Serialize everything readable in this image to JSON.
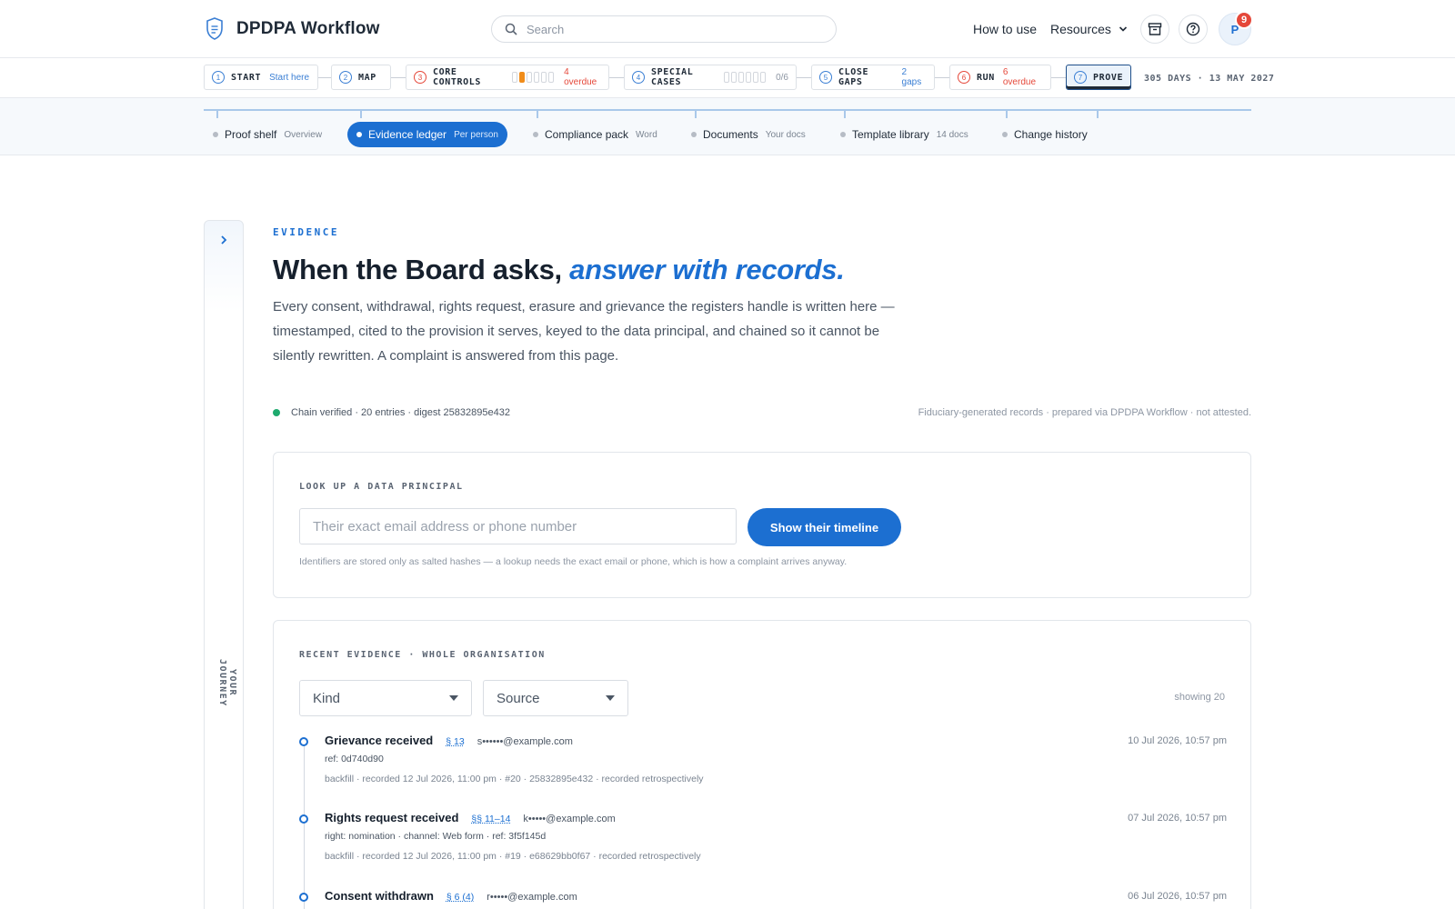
{
  "app": {
    "title": "DPDPA Workflow"
  },
  "search": {
    "placeholder": "Search"
  },
  "nav": {
    "how_to_use": "How to use",
    "resources": "Resources"
  },
  "user": {
    "initial": "P",
    "notifications": "9"
  },
  "steps": [
    {
      "num": "1",
      "label": "START",
      "meta": "Start here",
      "meta_tone": "blue"
    },
    {
      "num": "2",
      "label": "MAP",
      "meta": "",
      "meta_tone": "gray"
    },
    {
      "num": "3",
      "label": "CORE CONTROLS",
      "meta": "4 overdue",
      "meta_tone": "red",
      "progress_on": 1,
      "progress_total": 6
    },
    {
      "num": "4",
      "label": "SPECIAL CASES",
      "meta": "0/6",
      "meta_tone": "gray",
      "progress_on": 0,
      "progress_total": 6
    },
    {
      "num": "5",
      "label": "CLOSE GAPS",
      "meta": "2 gaps",
      "meta_tone": "blue"
    },
    {
      "num": "6",
      "label": "RUN",
      "meta": "6 overdue",
      "meta_tone": "red"
    },
    {
      "num": "7",
      "label": "PROVE",
      "meta": "",
      "meta_tone": "gray",
      "active": true
    }
  ],
  "deadline": "305 DAYS · 13 MAY 2027",
  "subtabs": [
    {
      "label": "Proof shelf",
      "hint": "Overview"
    },
    {
      "label": "Evidence ledger",
      "hint": "Per person",
      "active": true
    },
    {
      "label": "Compliance pack",
      "hint": "Word"
    },
    {
      "label": "Documents",
      "hint": "Your docs"
    },
    {
      "label": "Template library",
      "hint": "14 docs"
    },
    {
      "label": "Change history",
      "hint": ""
    }
  ],
  "rail": {
    "label": "YOUR JOURNEY"
  },
  "page": {
    "eyebrow": "EVIDENCE",
    "headline_plain": "When the Board asks, ",
    "headline_em": "answer with records.",
    "lede": "Every consent, withdrawal, rights request, erasure and grievance the registers handle is written here — timestamped, cited to the provision it serves, keyed to the data principal, and chained so it cannot be silently rewritten. A complaint is answered from this page.",
    "chain_status": "Chain verified · 20 entries · digest 25832895e432",
    "attestation": "Fiduciary-generated records · prepared via DPDPA Workflow · not attested."
  },
  "lookup": {
    "title": "LOOK UP A DATA PRINCIPAL",
    "placeholder": "Their exact email address or phone number",
    "button": "Show their timeline",
    "note": "Identifiers are stored only as salted hashes — a lookup needs the exact email or phone, which is how a complaint arrives anyway."
  },
  "recent": {
    "title": "RECENT EVIDENCE · WHOLE ORGANISATION",
    "filter_kind": "Kind",
    "filter_source": "Source",
    "showing": "showing 20",
    "entries": [
      {
        "title": "Grievance received",
        "cite": "§ 13",
        "who": "s••••••@example.com",
        "time": "10 Jul 2026, 10:57 pm",
        "detail": "ref: 0d740d90",
        "meta": "backfill · recorded 12 Jul 2026, 11:00 pm · #20 · 25832895e432 · recorded retrospectively"
      },
      {
        "title": "Rights request received",
        "cite": "§§ 11–14",
        "who": "k•••••@example.com",
        "time": "07 Jul 2026, 10:57 pm",
        "detail": "right: nomination · channel: Web form · ref: 3f5f145d",
        "meta": "backfill · recorded 12 Jul 2026, 11:00 pm · #19 · e68629bb0f67 · recorded retrospectively"
      },
      {
        "title": "Consent withdrawn",
        "cite": "§ 6 (4)",
        "who": "r•••••@example.com",
        "time": "06 Jul 2026, 10:57 pm",
        "detail": "",
        "meta": ""
      }
    ]
  },
  "colors": {
    "accent": "#1c6fd1",
    "danger": "#e5483a",
    "warning": "#f08c1a",
    "success": "#1eaa6e"
  }
}
